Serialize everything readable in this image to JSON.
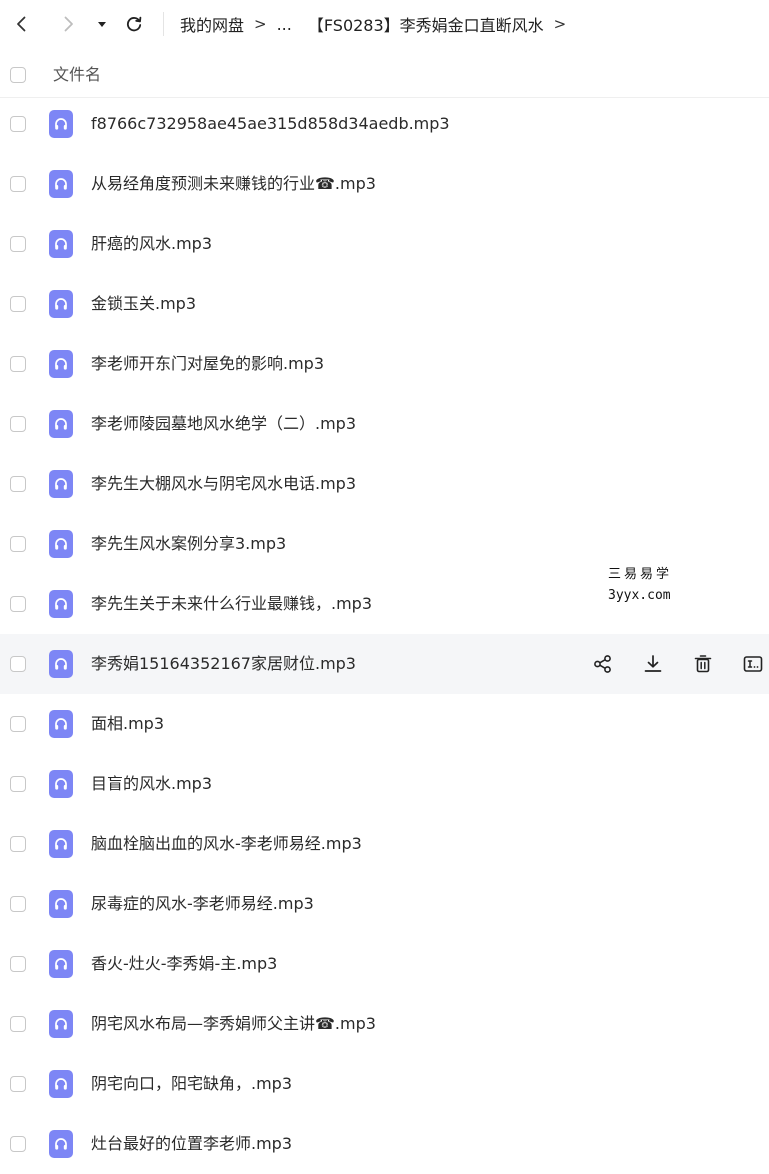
{
  "toolbar": {
    "back_icon": "chevron-left-icon",
    "forward_icon": "chevron-right-icon",
    "dropdown_icon": "caret-down-icon",
    "refresh_icon": "refresh-icon"
  },
  "breadcrumb": {
    "root": "我的网盘",
    "sep": ">",
    "ellipsis": "...",
    "current": "【FS0283】李秀娟金口直断风水",
    "trailing_sep": ">"
  },
  "list_header": {
    "name_label": "文件名"
  },
  "files": [
    {
      "name": "f8766c732958ae45ae315d858d34aedb.mp3"
    },
    {
      "name": "从易经角度预测未来赚钱的行业☎.mp3"
    },
    {
      "name": "肝癌的风水.mp3"
    },
    {
      "name": "金锁玉关.mp3"
    },
    {
      "name": "李老师开东门对屋免的影响.mp3"
    },
    {
      "name": "李老师陵园墓地风水绝学（二）.mp3"
    },
    {
      "name": "李先生大棚风水与阴宅风水电话.mp3"
    },
    {
      "name": "李先生风水案例分享3.mp3"
    },
    {
      "name": "李先生关于未来什么行业最赚钱，.mp3"
    },
    {
      "name": "李秀娟15164352167家居财位.mp3"
    },
    {
      "name": "面相.mp3"
    },
    {
      "name": "目盲的风水.mp3"
    },
    {
      "name": "脑血栓脑出血的风水-李老师易经.mp3"
    },
    {
      "name": "尿毒症的风水-李老师易经.mp3"
    },
    {
      "name": "香火-灶火-李秀娟-主.mp3"
    },
    {
      "name": "阴宅风水布局—李秀娟师父主讲☎.mp3"
    },
    {
      "name": "阴宅向口，阳宅缺角，.mp3"
    },
    {
      "name": "灶台最好的位置李老师.mp3"
    }
  ],
  "hover_row_index": 9,
  "row_actions": {
    "share_icon": "share-icon",
    "download_icon": "download-icon",
    "delete_icon": "trash-icon",
    "rename_icon": "rename-icon"
  },
  "file_icon": "audio-file-icon",
  "colors": {
    "file_icon_bg": "#7d86f5",
    "hover_row_bg": "#f5f6f8",
    "checkbox_border": "#c8c8c8"
  },
  "watermark": {
    "line1": "三易易学",
    "line2": "3yyx.com"
  }
}
